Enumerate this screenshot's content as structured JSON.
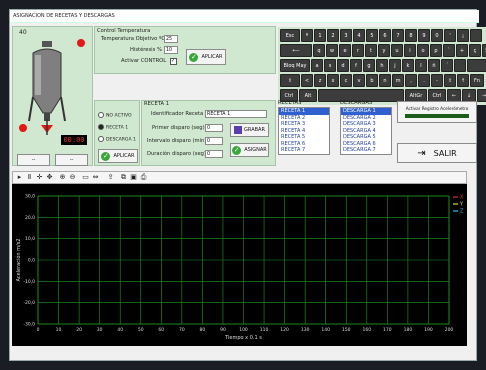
{
  "window_title": "ASIGNACION DE RECETAS Y DESCARGAS",
  "tank": {
    "label": "40"
  },
  "timer_display": "00:00",
  "control": {
    "title": "Control Temperatura",
    "temp_label": "Temperatura Objetivo ºC",
    "temp_value": "25",
    "hist_label": "Histéresis %",
    "hist_value": "10",
    "activar_label": "Activar CONTROL",
    "apply_label": "APLICAR"
  },
  "mode": {
    "options": [
      "NO ACTIVO",
      "RECETA 1",
      "DESCARGA 1"
    ],
    "selected": 1,
    "apply_label": "APLICAR"
  },
  "receta": {
    "title": "RECETA 1",
    "id_label": "Identificador Receta",
    "id_value": "RECETA 1",
    "primer_label": "Primer disparo (seg)",
    "primer_value": "0",
    "intervalo_label": "Intervalo disparo (min)",
    "intervalo_value": "0",
    "duracion_label": "Duración disparo (seg)",
    "duracion_value": "0",
    "grabar_label": "GRABAR",
    "asignar_label": "ASIGNAR"
  },
  "keyboard": {
    "rows": [
      [
        "Esc",
        "º",
        "1",
        "2",
        "3",
        "4",
        "5",
        "6",
        "7",
        "8",
        "9",
        "0",
        "'",
        "¡",
        ""
      ],
      [
        "⟵",
        "q",
        "w",
        "e",
        "r",
        "t",
        "y",
        "u",
        "i",
        "o",
        "p",
        "`",
        "+",
        "ç",
        "Supr"
      ],
      [
        "Bloq May",
        "a",
        "s",
        "d",
        "f",
        "g",
        "h",
        "j",
        "k",
        "l",
        "ñ",
        "´",
        "",
        ""
      ],
      [
        "⇧",
        "<",
        "z",
        "x",
        "c",
        "v",
        "b",
        "n",
        "m",
        ",",
        ".",
        "-",
        "⇧",
        "↑",
        "Fn"
      ],
      [
        "Ctrl",
        "Alt",
        "",
        "AltGr",
        "Ctrl",
        "←",
        "↓",
        "→"
      ]
    ]
  },
  "recetas": {
    "title": "RECETAS",
    "items": [
      "RECETA 1",
      "RECETA 2",
      "RECETA 3",
      "RECETA 4",
      "RECETA 5",
      "RECETA 6",
      "RECETA 7"
    ],
    "selected": 0
  },
  "descargas": {
    "title": "DESCARGAS",
    "items": [
      "DESCARGA 1",
      "DESCARGA 2",
      "DESCARGA 3",
      "DESCARGA 4",
      "DESCARGA 5",
      "DESCARGA 6",
      "DESCARGA 7"
    ],
    "selected": 0
  },
  "registro": {
    "label": "Activar Registro Acelerómetro"
  },
  "salir_label": "SALIR",
  "left_buttons": [
    "--",
    "--"
  ],
  "colors": {
    "panel": "#cfe8cf",
    "chart_bg": "#000000",
    "grid": "#1f9b1f",
    "x_series": "#e03030",
    "y_series": "#e0e030",
    "z_series": "#30c0e0"
  },
  "chart_data": {
    "type": "line",
    "xlabel": "Tiempo x 0.1 s",
    "ylabel": "Aceleración m/s2",
    "xlim": [
      0,
      200
    ],
    "ylim": [
      -30,
      30
    ],
    "xticks": [
      "0",
      "10",
      "20",
      "30",
      "40",
      "50",
      "60",
      "70",
      "80",
      "90",
      "100",
      "110",
      "120",
      "130",
      "140",
      "150",
      "160",
      "170",
      "180",
      "190",
      "200"
    ],
    "yticks": [
      "30,0",
      "20,0",
      "10,0",
      "0,0",
      "-10,0",
      "-20,0",
      "-30,0"
    ],
    "series": [
      {
        "name": "X",
        "values": []
      },
      {
        "name": "Y",
        "values": []
      },
      {
        "name": "Z",
        "values": []
      }
    ],
    "grid": true,
    "legend": "top-right"
  }
}
